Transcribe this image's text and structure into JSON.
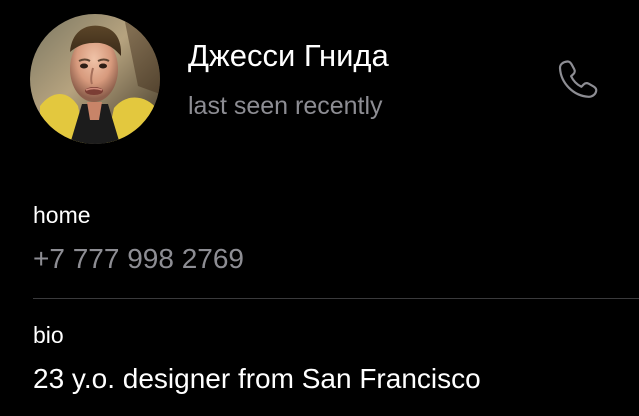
{
  "contact": {
    "name": "Джесси Гнида",
    "status": "last seen recently",
    "avatar_icon": "contact-photo"
  },
  "actions": {
    "call_icon": "phone-icon"
  },
  "phone": {
    "label": "home",
    "value": "+7 777 998 2769"
  },
  "bio": {
    "label": "bio",
    "value": "23 y.o. designer from San Francisco"
  },
  "colors": {
    "background": "#000000",
    "primary_text": "#ffffff",
    "secondary_text": "#8d8d93",
    "divider": "#3a3a3c"
  }
}
